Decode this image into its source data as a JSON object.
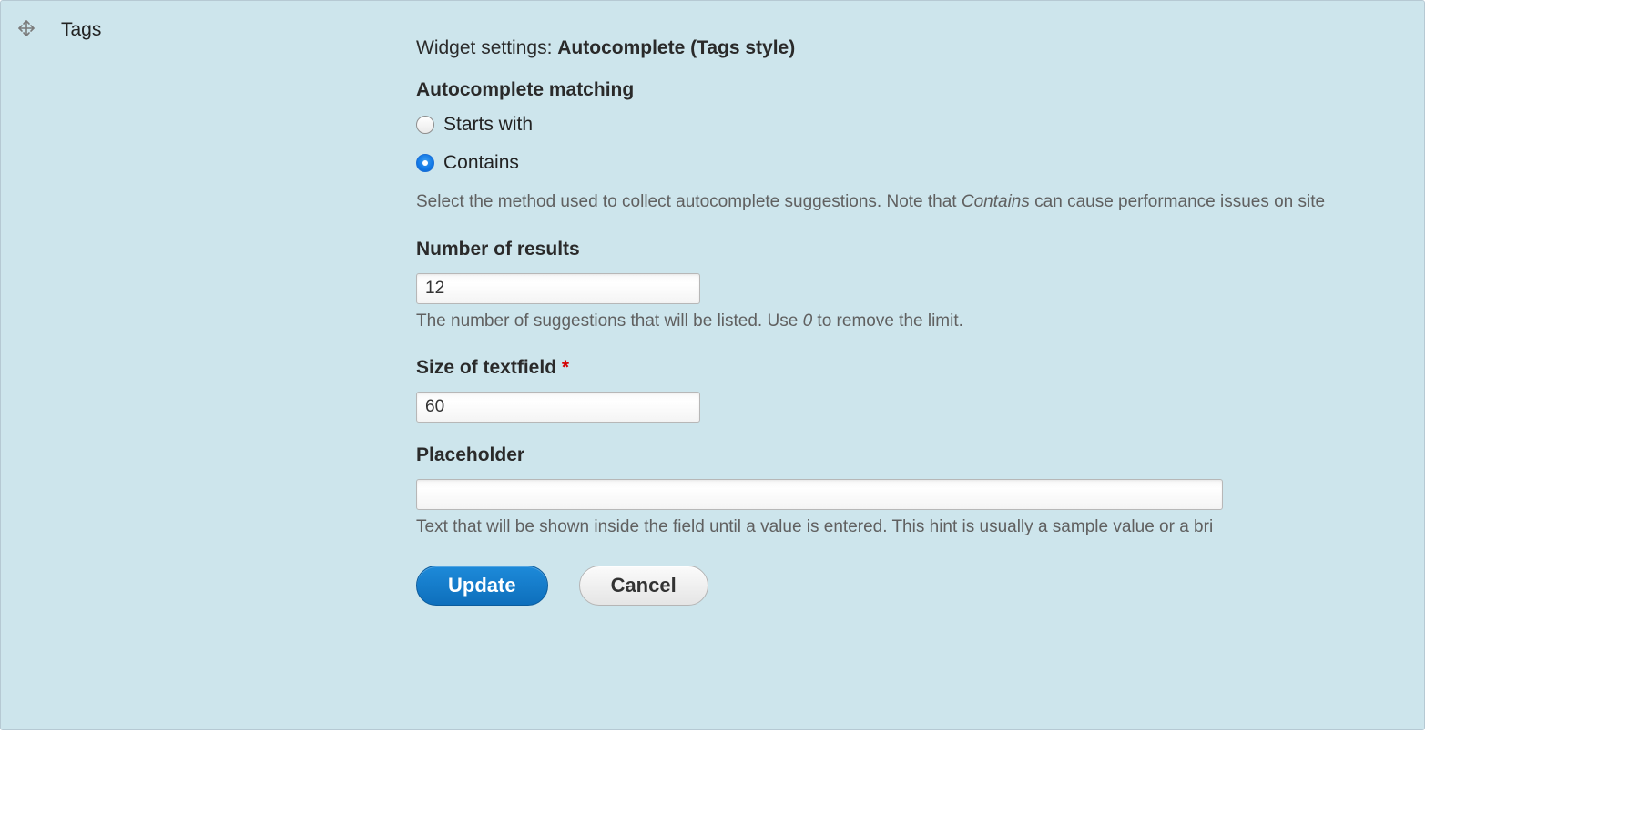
{
  "field_name": "Tags",
  "widget": {
    "settings_label": "Widget settings:",
    "name": "Autocomplete (Tags style)"
  },
  "matching": {
    "legend": "Autocomplete matching",
    "options": {
      "starts_with": "Starts with",
      "contains": "Contains"
    },
    "selected": "contains",
    "description_pre": "Select the method used to collect autocomplete suggestions. Note that ",
    "description_ital": "Contains",
    "description_post": " can cause performance issues on site"
  },
  "results": {
    "label": "Number of results",
    "value": "12",
    "description_pre": "The number of suggestions that will be listed. Use ",
    "description_ital": "0",
    "description_post": " to remove the limit."
  },
  "size": {
    "label": "Size of textfield",
    "required_mark": "*",
    "value": "60"
  },
  "placeholder_field": {
    "label": "Placeholder",
    "value": "",
    "description": "Text that will be shown inside the field until a value is entered. This hint is usually a sample value or a bri"
  },
  "buttons": {
    "update": "Update",
    "cancel": "Cancel"
  }
}
